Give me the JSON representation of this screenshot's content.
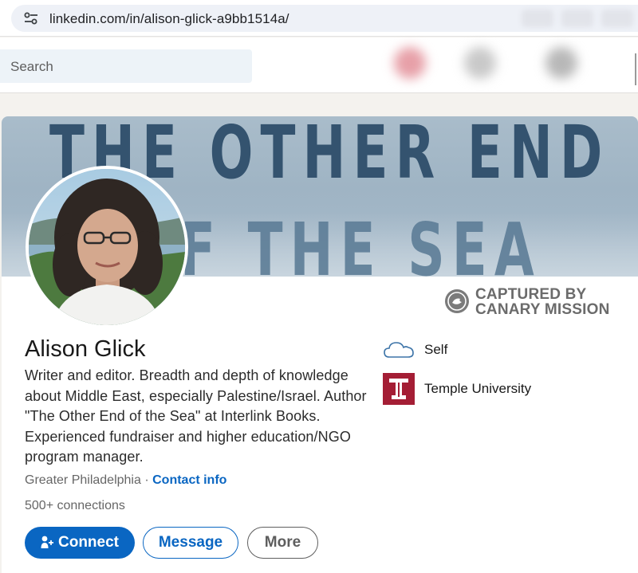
{
  "browser": {
    "url": "linkedin.com/in/alison-glick-a9bb1514a/"
  },
  "nav": {
    "search_placeholder": "Search"
  },
  "banner": {
    "line1": "THE OTHER END",
    "line2": "F THE SEA"
  },
  "watermark": {
    "line1": "CAPTURED BY",
    "line2": "CANARY MISSION"
  },
  "profile": {
    "name": "Alison Glick",
    "headline": "Writer and editor. Breadth and depth of knowledge about Middle East, especially Palestine/Israel. Author \"The Other End of the Sea\" at Interlink Books. Experienced fundraiser and higher education/NGO program manager.",
    "location": "Greater Philadelphia",
    "separator": "·",
    "contact_info": "Contact info",
    "connections": "500+ connections"
  },
  "actions": {
    "connect": "Connect",
    "message": "Message",
    "more": "More"
  },
  "experience": {
    "current": "Self",
    "education": "Temple University"
  },
  "colors": {
    "linkedin_blue": "#0a66c2",
    "temple_red": "#a41e35"
  },
  "icons": [
    "tune-icon",
    "search-icon",
    "cloud-icon",
    "temple-logo",
    "person-add-icon",
    "canary-mission-logo"
  ]
}
